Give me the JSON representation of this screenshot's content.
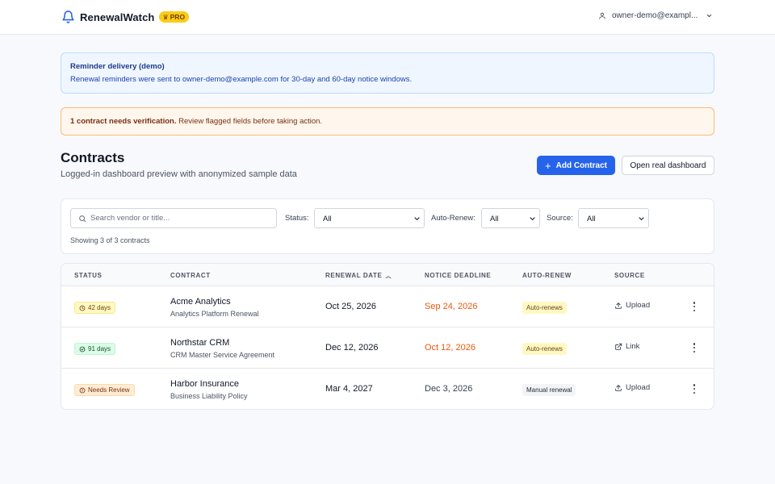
{
  "header": {
    "app_name": "RenewalWatch",
    "badge": "PRO",
    "badge_icon": "crown-icon",
    "user_email": "owner-demo@exampl..."
  },
  "info_banner": {
    "title": "Reminder delivery (demo)",
    "text": "Renewal reminders were sent to owner-demo@example.com for 30-day and 60-day notice windows."
  },
  "warning_banner": {
    "bold": "1 contract needs verification.",
    "text": " Review flagged fields before taking action."
  },
  "page": {
    "title": "Contracts",
    "subtitle": "Logged-in dashboard preview with anonymized sample data",
    "add_button": "Add Contract",
    "open_button": "Open real dashboard"
  },
  "filters": {
    "search_placeholder": "Search vendor or title...",
    "status_label": "Status:",
    "status_value": "All",
    "autorenew_label": "Auto-Renew:",
    "autorenew_value": "All",
    "source_label": "Source:",
    "source_value": "All",
    "showing": "Showing 3 of 3 contracts"
  },
  "table": {
    "columns": [
      "STATUS",
      "CONTRACT",
      "RENEWAL DATE",
      "NOTICE DEADLINE",
      "AUTO-RENEW",
      "SOURCE"
    ],
    "rows": [
      {
        "status": "42 days",
        "status_icon": "clock-icon",
        "name": "Acme Analytics",
        "title": "Analytics Platform Renewal",
        "renewal_date": "Oct 25, 2026",
        "notice_deadline": "Sep 24, 2026",
        "auto_renew": "Auto-renews",
        "source": "Upload",
        "source_icon": "upload-icon"
      },
      {
        "status": "91 days",
        "status_icon": "check-circle-icon",
        "name": "Northstar CRM",
        "title": "CRM Master Service Agreement",
        "renewal_date": "Dec 12, 2026",
        "notice_deadline": "Oct 12, 2026",
        "auto_renew": "Auto-renews",
        "source": "Link",
        "source_icon": "external-link-icon"
      },
      {
        "status": "Needs Review",
        "status_icon": "alert-circle-icon",
        "name": "Harbor Insurance",
        "title": "Business Liability Policy",
        "renewal_date": "Mar 4, 2027",
        "notice_deadline": "Dec 3, 2026",
        "auto_renew": "Manual renewal",
        "source": "Upload",
        "source_icon": "upload-icon"
      }
    ]
  },
  "colors": {
    "primary": "#2563eb",
    "urgent": "#ea580c",
    "pro_badge": "#facc15",
    "info_bg": "#eff6ff",
    "warn_bg": "#fff7ed"
  }
}
